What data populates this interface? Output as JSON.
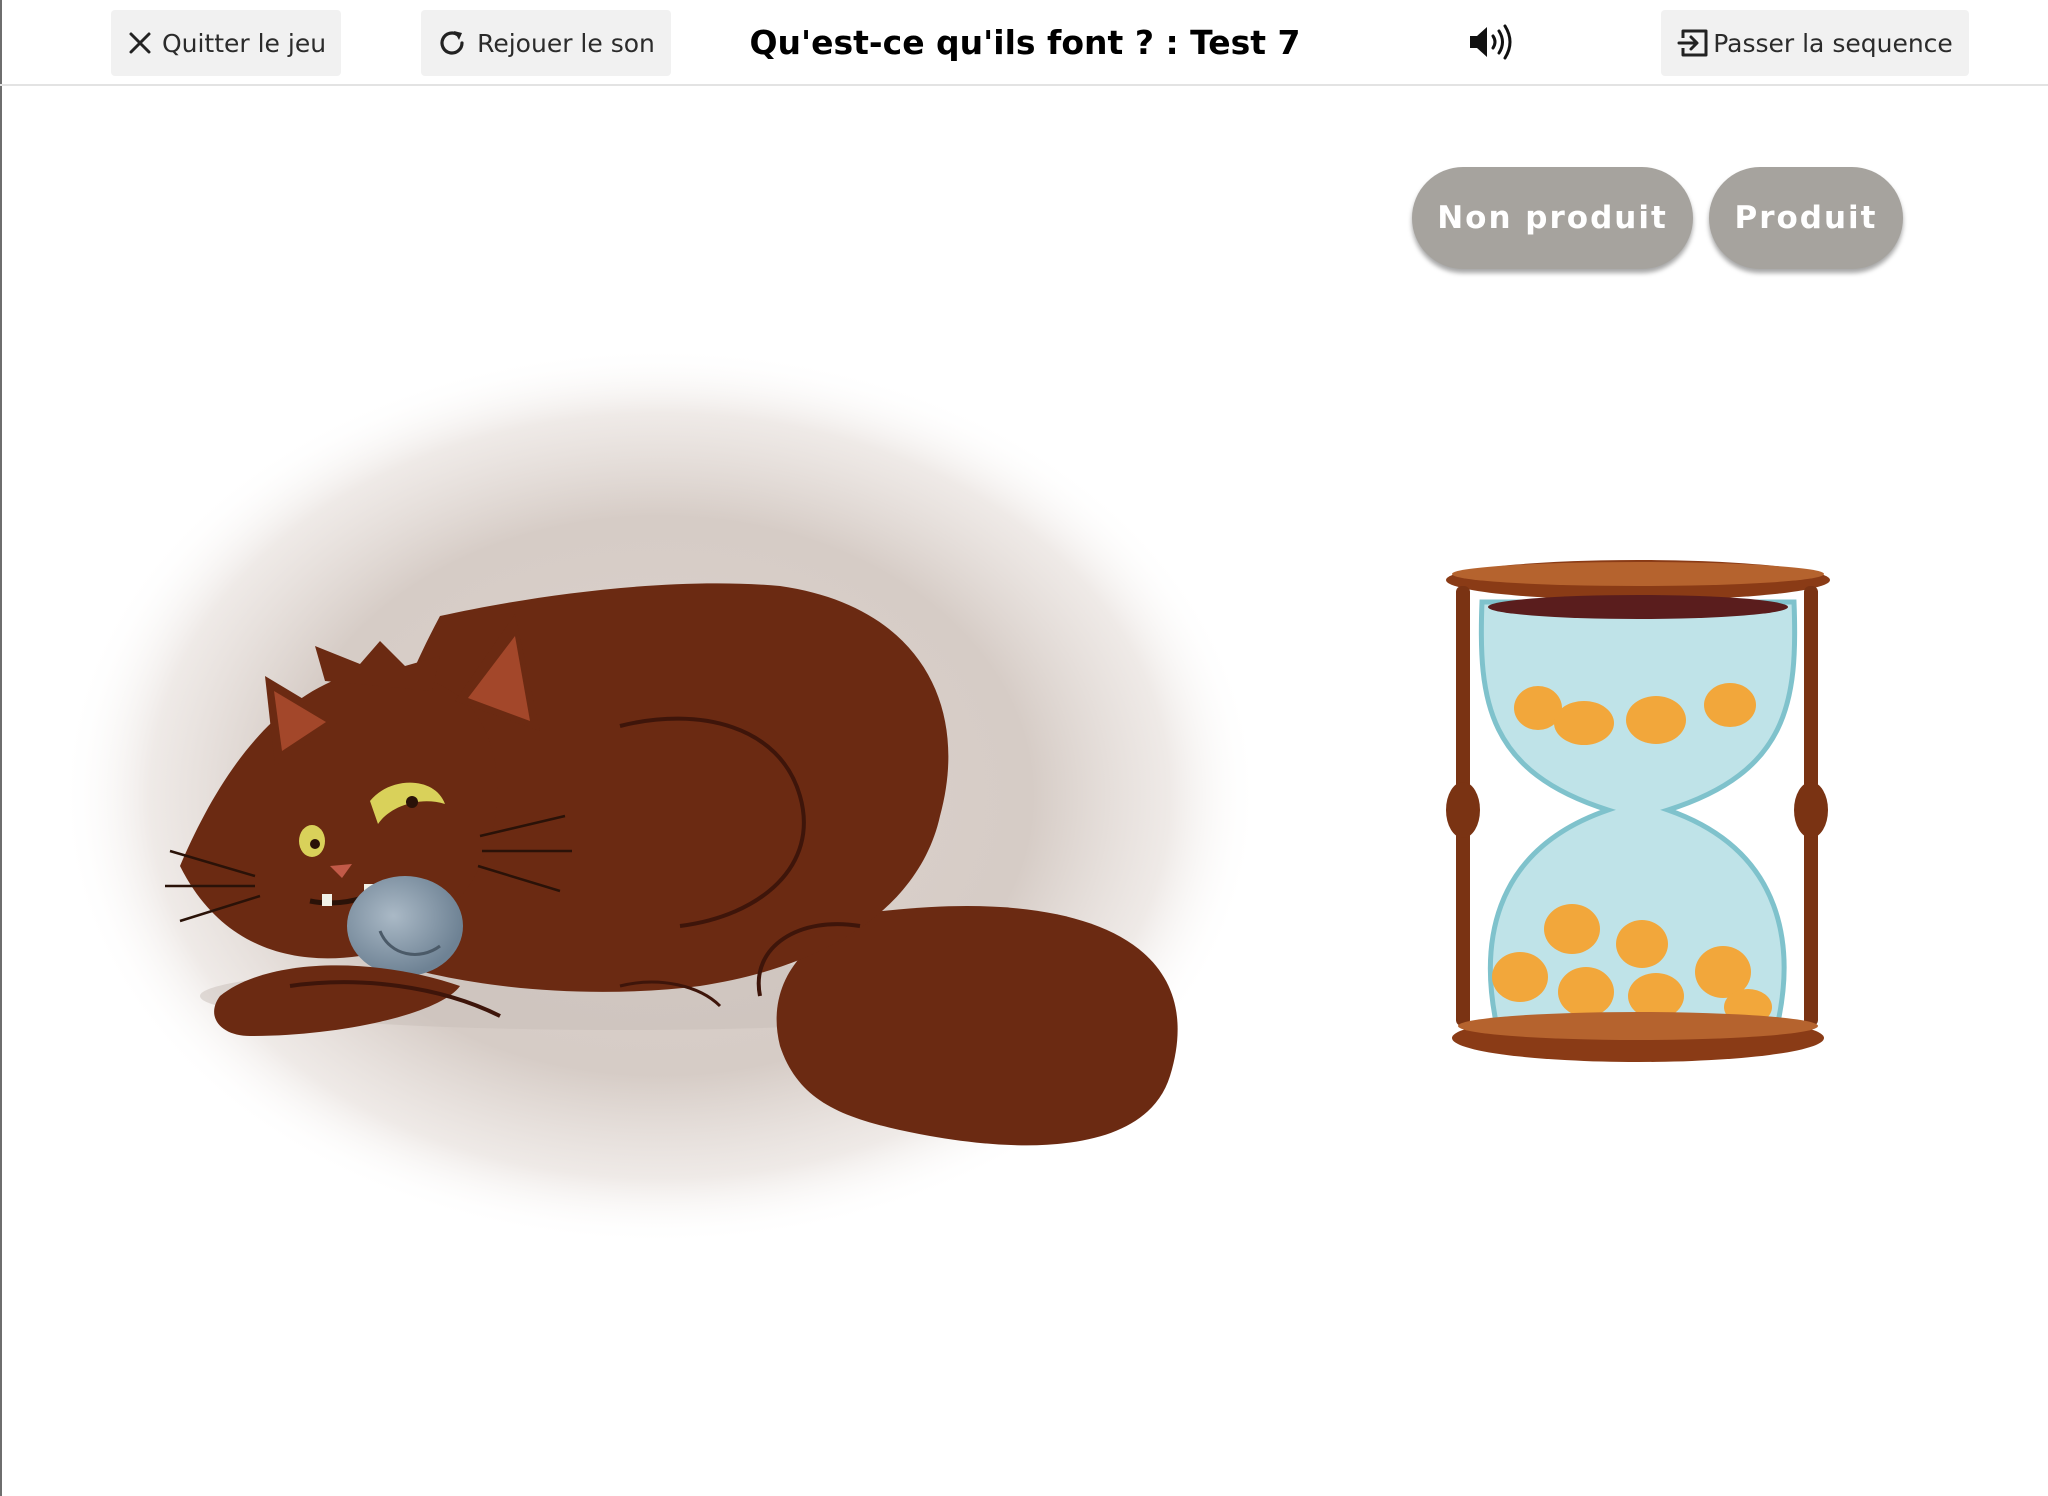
{
  "toolbar": {
    "quit_label": "Quitter le jeu",
    "replay_label": "Rejouer le son",
    "title": "Qu'est-ce qu'ils font ? : Test 7",
    "skip_label": "Passer la sequence"
  },
  "choices": {
    "non_produit": "Non produit",
    "produit": "Produit"
  },
  "icons": {
    "quit": "close-icon",
    "replay": "refresh-icon",
    "speaker": "speaker-icon",
    "skip": "exit-icon"
  },
  "colors": {
    "choice_button": "#a6a39e",
    "toolbar_button": "#f1f1f1",
    "cat_fur": "#6b2a12",
    "hourglass_wood": "#8a3b16",
    "hourglass_glass": "#bfe3e8",
    "grains": "#f2a73b"
  }
}
